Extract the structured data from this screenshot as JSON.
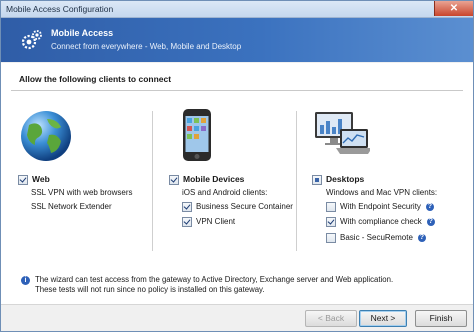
{
  "window": {
    "title": "Mobile Access Configuration"
  },
  "banner": {
    "title": "Mobile Access",
    "subtitle": "Connect from everywhere - Web, Mobile and Desktop",
    "icon": "gears-icon"
  },
  "main": {
    "heading": "Allow the following clients to connect",
    "web": {
      "label": "Web",
      "checked": true,
      "lines": [
        "SSL VPN with web browsers",
        "SSL Network Extender"
      ]
    },
    "mobile": {
      "label": "Mobile Devices",
      "checked": true,
      "intro": "iOS and Android clients:",
      "options": [
        {
          "label": "Business Secure Container",
          "checked": true
        },
        {
          "label": "VPN Client",
          "checked": true
        }
      ]
    },
    "desktops": {
      "label": "Desktops",
      "state": "partial",
      "intro": "Windows and Mac VPN clients:",
      "options": [
        {
          "label": "With Endpoint Security",
          "checked": false
        },
        {
          "label": "With compliance check",
          "checked": true
        },
        {
          "label": "Basic - SecuRemote",
          "checked": false
        }
      ]
    },
    "note_line1": "The wizard can test access from the gateway to Active Directory, Exchange server and Web application.",
    "note_line2": "These tests will not run since no policy is installed on this gateway."
  },
  "footer": {
    "back": "< Back",
    "next": "Next >",
    "finish": "Finish"
  },
  "colors": {
    "banner": "#3b72bf",
    "accent": "#2e61b8"
  }
}
